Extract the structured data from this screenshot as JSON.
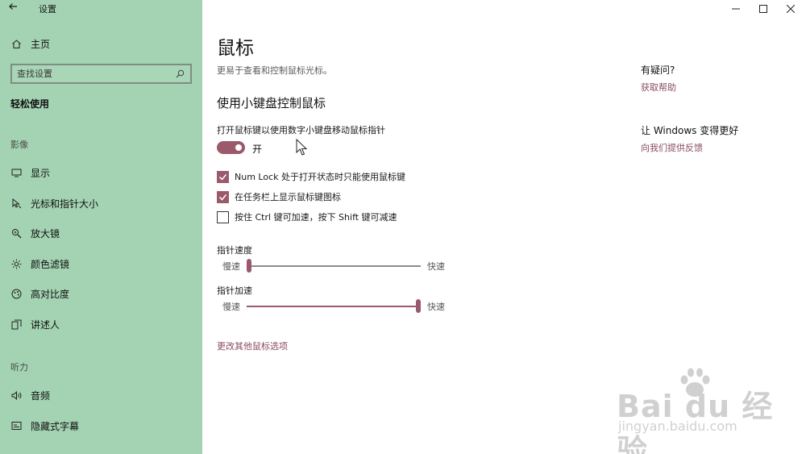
{
  "window": {
    "app_title": "设置",
    "back_icon": "back-arrow-icon",
    "controls": [
      "minimize-icon",
      "maximize-icon",
      "close-icon"
    ]
  },
  "sidebar": {
    "home": {
      "label": "主页",
      "icon": "home-icon"
    },
    "search": {
      "placeholder": "查找设置",
      "icon": "search-icon"
    },
    "category": "轻松使用",
    "groups": [
      {
        "title": "影像",
        "items": [
          {
            "label": "显示",
            "icon": "display-icon"
          },
          {
            "label": "光标和指针大小",
            "icon": "cursor-size-icon"
          },
          {
            "label": "放大镜",
            "icon": "magnifier-icon"
          },
          {
            "label": "颜色滤镜",
            "icon": "color-filter-icon"
          },
          {
            "label": "高对比度",
            "icon": "high-contrast-icon"
          },
          {
            "label": "讲述人",
            "icon": "narrator-icon"
          }
        ]
      },
      {
        "title": "听力",
        "items": [
          {
            "label": "音频",
            "icon": "audio-icon"
          },
          {
            "label": "隐藏式字幕",
            "icon": "captions-icon"
          }
        ]
      }
    ]
  },
  "main": {
    "title": "鼠标",
    "description": "更易于查看和控制鼠标光标。",
    "section_title": "使用小键盘控制鼠标",
    "toggle": {
      "label": "打开鼠标键以使用数字小键盘移动鼠标指针",
      "state_text": "开",
      "on": true
    },
    "checkboxes": [
      {
        "label": "Num Lock 处于打开状态时只能使用鼠标键",
        "checked": true
      },
      {
        "label": "在任务栏上显示鼠标键图标",
        "checked": true
      },
      {
        "label": "按住 Ctrl 键可加速，按下 Shift 键可减速",
        "checked": false
      }
    ],
    "sliders": [
      {
        "title": "指针速度",
        "min_label": "慢速",
        "max_label": "快速",
        "value": 0.0
      },
      {
        "title": "指针加速",
        "min_label": "慢速",
        "max_label": "快速",
        "value": 1.0
      }
    ],
    "more_link": "更改其他鼠标选项"
  },
  "aside": {
    "help_title": "有疑问?",
    "help_link": "获取帮助",
    "better_title": "让 Windows 变得更好",
    "better_link": "向我们提供反馈"
  },
  "watermark": {
    "logo": "Bai du 经验",
    "url": "jingyan.baidu.com"
  },
  "colors": {
    "sidebar_bg": "#a3d3b2",
    "accent": "#9b5a6b",
    "link": "#8a4b5d"
  }
}
